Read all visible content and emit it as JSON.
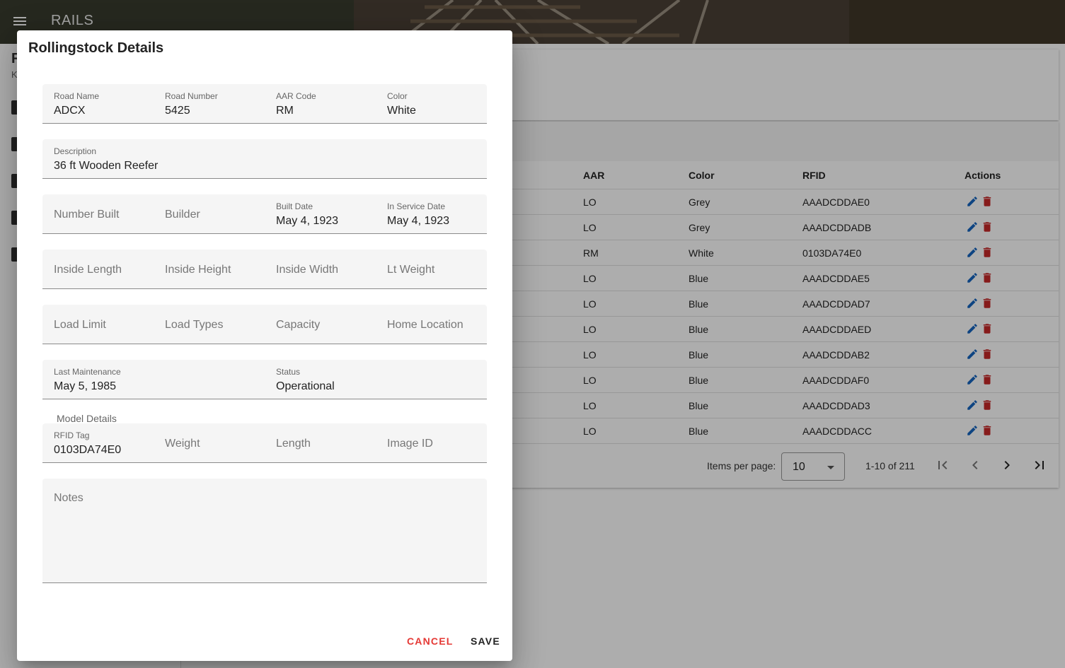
{
  "app": {
    "title": "RAILS"
  },
  "sidebar": {
    "title": "R",
    "subtitle": "K"
  },
  "table": {
    "headers": {
      "aar": "AAR",
      "color": "Color",
      "rfid": "RFID",
      "actions": "Actions"
    },
    "rows": [
      {
        "aar": "LO",
        "color": "Grey",
        "rfid": "AAADCDDAE0"
      },
      {
        "aar": "LO",
        "color": "Grey",
        "rfid": "AAADCDDADB"
      },
      {
        "aar": "RM",
        "color": "White",
        "rfid": "0103DA74E0"
      },
      {
        "aar": "LO",
        "color": "Blue",
        "rfid": "AAADCDDAE5"
      },
      {
        "aar": "LO",
        "color": "Blue",
        "rfid": "AAADCDDAD7"
      },
      {
        "aar": "LO",
        "color": "Blue",
        "rfid": "AAADCDDAED"
      },
      {
        "aar": "LO",
        "color": "Blue",
        "rfid": "AAADCDDAB2"
      },
      {
        "aar": "LO",
        "color": "Blue",
        "rfid": "AAADCDDAF0"
      },
      {
        "aar": "LO",
        "color": "Blue",
        "rfid": "AAADCDDAD3"
      },
      {
        "aar": "LO",
        "color": "Blue",
        "rfid": "AAADCDDACC"
      }
    ],
    "paginator": {
      "items_per_page_label": "Items per page:",
      "page_size": "10",
      "range": "1-10 of 211"
    }
  },
  "dialog": {
    "title": "Rollingstock Details",
    "road_name": {
      "label": "Road Name",
      "value": "ADCX"
    },
    "road_number": {
      "label": "Road Number",
      "value": "5425"
    },
    "aar_code": {
      "label": "AAR Code",
      "value": "RM"
    },
    "color": {
      "label": "Color",
      "value": "White"
    },
    "description": {
      "label": "Description",
      "value": "36 ft Wooden Reefer"
    },
    "number_built": {
      "placeholder": "Number Built"
    },
    "builder": {
      "placeholder": "Builder"
    },
    "built_date": {
      "label": "Built Date",
      "value": "May 4, 1923"
    },
    "in_service_date": {
      "label": "In Service Date",
      "value": "May 4, 1923"
    },
    "inside_length": {
      "placeholder": "Inside Length"
    },
    "inside_height": {
      "placeholder": "Inside Height"
    },
    "inside_width": {
      "placeholder": "Inside Width"
    },
    "lt_weight": {
      "placeholder": "Lt Weight"
    },
    "load_limit": {
      "placeholder": "Load Limit"
    },
    "load_types": {
      "placeholder": "Load Types"
    },
    "capacity": {
      "placeholder": "Capacity"
    },
    "home_location": {
      "placeholder": "Home Location"
    },
    "last_maintenance": {
      "label": "Last Maintenance",
      "value": "May 5, 1985"
    },
    "status": {
      "label": "Status",
      "value": "Operational"
    },
    "model_details_label": "Model Details",
    "rfid_tag": {
      "label": "RFID Tag",
      "value": "0103DA74E0"
    },
    "weight": {
      "placeholder": "Weight"
    },
    "length": {
      "placeholder": "Length"
    },
    "image_id": {
      "placeholder": "Image ID"
    },
    "notes": {
      "placeholder": "Notes"
    },
    "cancel_label": "CANCEL",
    "save_label": "SAVE"
  },
  "colors": {
    "edit_icon": "#1565c0",
    "delete_icon": "#c62828",
    "cancel": "#e53935"
  }
}
